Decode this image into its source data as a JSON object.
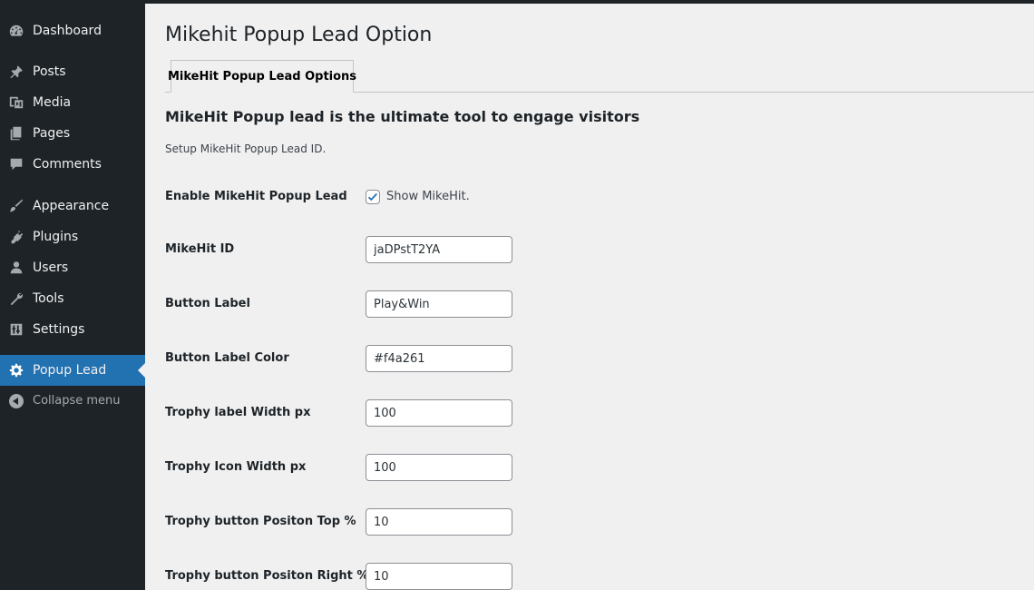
{
  "sidebar": {
    "items": [
      {
        "label": "Dashboard",
        "icon": "dashboard-icon"
      },
      {
        "label": "Posts",
        "icon": "pin-icon"
      },
      {
        "label": "Media",
        "icon": "media-icon"
      },
      {
        "label": "Pages",
        "icon": "pages-icon"
      },
      {
        "label": "Comments",
        "icon": "comment-icon"
      },
      {
        "label": "Appearance",
        "icon": "brush-icon"
      },
      {
        "label": "Plugins",
        "icon": "plug-icon"
      },
      {
        "label": "Users",
        "icon": "user-icon"
      },
      {
        "label": "Tools",
        "icon": "wrench-icon"
      },
      {
        "label": "Settings",
        "icon": "settings-sliders-icon"
      },
      {
        "label": "Popup Lead",
        "icon": "gear-icon",
        "active": true
      }
    ],
    "collapse_label": "Collapse menu"
  },
  "page": {
    "title": "Mikehit Popup Lead Option",
    "tab_label": "MikeHit Popup Lead Options",
    "section_title": "MikeHit Popup lead is the ultimate tool to engage visitors",
    "section_desc": "Setup MikeHit Popup Lead ID."
  },
  "form": {
    "enable": {
      "label": "Enable MikeHit Popup Lead",
      "checkbox_label": "Show MikeHit.",
      "checked": true
    },
    "fields": [
      {
        "label": "MikeHit ID",
        "value": "jaDPstT2YA"
      },
      {
        "label": "Button Label",
        "value": "Play&Win"
      },
      {
        "label": "Button Label Color",
        "value": "#f4a261"
      },
      {
        "label": "Trophy label Width px",
        "value": "100"
      },
      {
        "label": "Trophy Icon Width px",
        "value": "100"
      },
      {
        "label": "Trophy button Positon Top %",
        "value": "10"
      },
      {
        "label": "Trophy button Positon Right %",
        "value": "10"
      }
    ]
  },
  "colors": {
    "sidebar_bg": "#1d2327",
    "active_bg": "#2271b1",
    "content_bg": "#f0f0f1",
    "checkbox_accent": "#2271b1"
  }
}
